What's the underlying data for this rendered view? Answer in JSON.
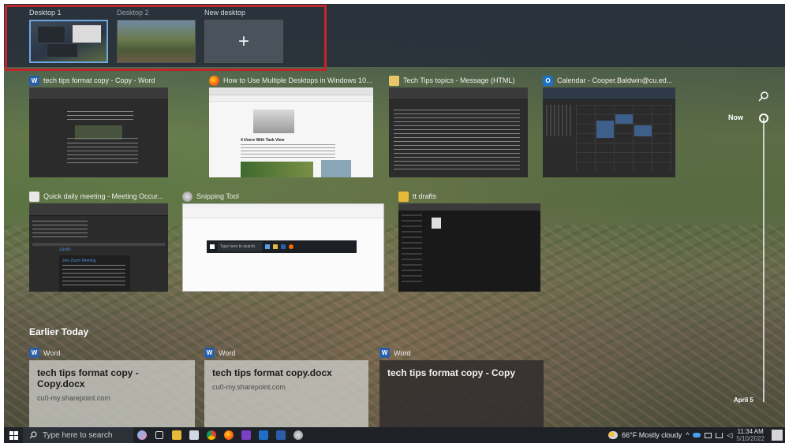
{
  "desktops": {
    "items": [
      {
        "label": "Desktop 1"
      },
      {
        "label": "Desktop 2"
      },
      {
        "label": "New desktop"
      }
    ],
    "add_symbol": "+"
  },
  "windows": [
    {
      "title": "tech tips format copy - Copy - Word",
      "icon": "word-icon"
    },
    {
      "title": "How to Use Multiple Desktops in Windows 10...",
      "icon": "firefox-icon"
    },
    {
      "title": "Tech Tips topics - Message (HTML)",
      "icon": "outlook-message-icon"
    },
    {
      "title": "Calendar - Cooper.Baldwin@cu.ed...",
      "icon": "outlook-icon"
    },
    {
      "title": "Quick daily meeting - Meeting Occur...",
      "icon": "teams-icon"
    },
    {
      "title": "Snipping Tool",
      "icon": "snipping-tool-icon"
    },
    {
      "title": "tt drafts",
      "icon": "folder-icon"
    }
  ],
  "firefox_page": {
    "heading": "4 Users With Task View"
  },
  "snipping_page": {
    "search_placeholder": "Type here to search"
  },
  "teams_page": {
    "brand": "zoom",
    "meeting": "Join Zoom Meeting"
  },
  "earlier": {
    "heading": "Earlier Today",
    "cards": [
      {
        "app": "Word",
        "title": "tech tips format copy - Copy.docx",
        "subtitle": "cu0-my.sharepoint.com"
      },
      {
        "app": "Word",
        "title": "tech tips format copy.docx",
        "subtitle": "cu0-my.sharepoint.com"
      },
      {
        "app": "Word",
        "title": "tech tips format copy - Copy",
        "subtitle": ""
      }
    ]
  },
  "timeline": {
    "now_label": "Now",
    "end_label": "April 5"
  },
  "taskbar": {
    "search_placeholder": "Type here to search",
    "weather": "66°F  Mostly cloudy",
    "time": "11:34 AM",
    "date": "5/10/2022"
  },
  "colors": {
    "highlight": "#c0272d",
    "word": "#2b5ea8",
    "active_border": "#6fa8dc"
  }
}
